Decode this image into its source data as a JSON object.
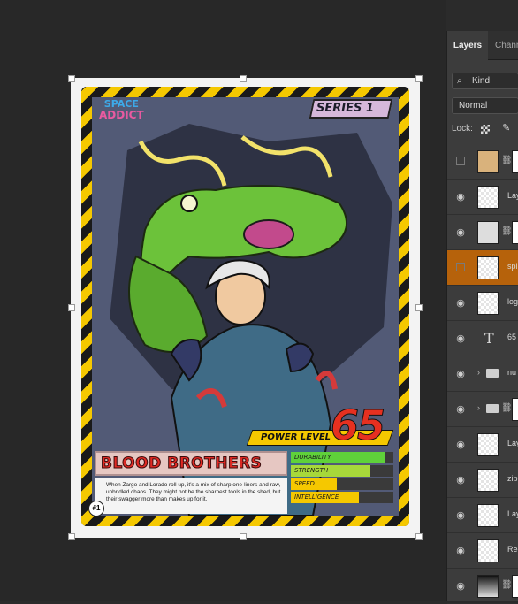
{
  "card": {
    "series": "SERIES 1",
    "logo_top": "SPACE",
    "logo_bottom": "ADDICT",
    "power_level_value": "65",
    "power_level_label": "POWER LEVEL",
    "name": "BLOOD BROTHERS",
    "description": "When Zargo and Lorado roll up, it's a mix of sharp one-liners and raw, unbridled chaos. They might not be the sharpest tools in the shed, but their swagger more than makes up for it.",
    "number": "#1",
    "stats": [
      {
        "label": "DURABILITY",
        "value": 0.92,
        "color": "#5fd13a"
      },
      {
        "label": "STRENGTH",
        "value": 0.78,
        "color": "#a7d83a"
      },
      {
        "label": "SPEED",
        "value": 0.45,
        "color": "#f5c800"
      },
      {
        "label": "INTELLIGENCE",
        "value": 0.66,
        "color": "#f5c800"
      }
    ]
  },
  "panel": {
    "tab_active": "Layers",
    "tab_inactive": "Chann",
    "kind_filter": "Kind",
    "blend_mode": "Normal",
    "lock_label": "Lock:",
    "layers": [
      {
        "name": "",
        "visible": false,
        "thumb": "tan",
        "mask": true
      },
      {
        "name": "Lay",
        "visible": true,
        "thumb": "checker"
      },
      {
        "name": "",
        "visible": true,
        "thumb": "dark",
        "mask": true
      },
      {
        "name": "spl",
        "visible": false,
        "thumb": "checker",
        "selected": true
      },
      {
        "name": "logo",
        "visible": true,
        "thumb": "checker"
      },
      {
        "name": "65",
        "visible": true,
        "type": "text"
      },
      {
        "name": "nu",
        "visible": true,
        "type": "group"
      },
      {
        "name": "",
        "visible": true,
        "type": "group",
        "mask": true
      },
      {
        "name": "Lay",
        "visible": true,
        "thumb": "checker"
      },
      {
        "name": "zip",
        "visible": true,
        "thumb": "checker"
      },
      {
        "name": "Lay",
        "visible": true,
        "thumb": "checker"
      },
      {
        "name": "Rec",
        "visible": true,
        "thumb": "checker"
      },
      {
        "name": "",
        "visible": true,
        "thumb": "grad",
        "mask": true
      }
    ]
  }
}
